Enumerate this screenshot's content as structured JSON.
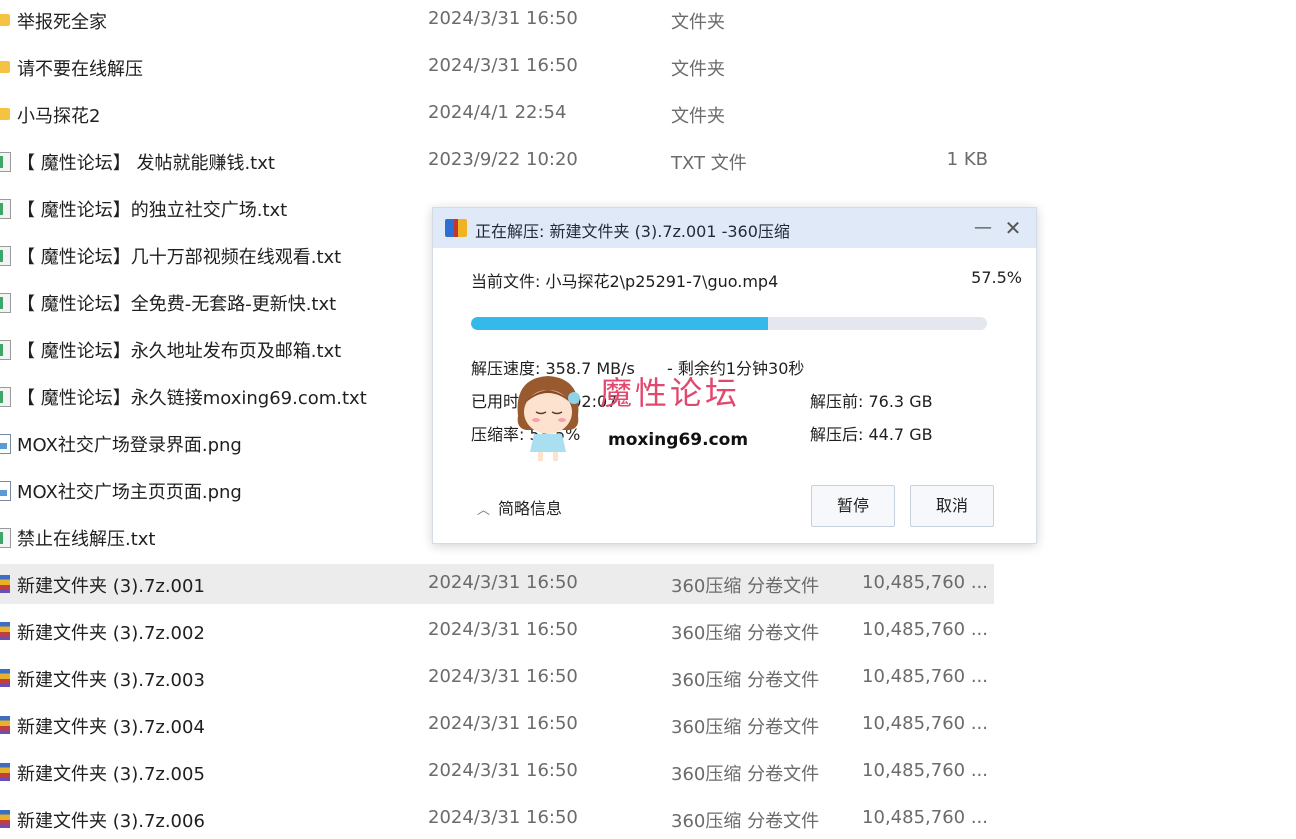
{
  "files": [
    {
      "icon": "folder-icon",
      "kind": "folder",
      "name": "举报死全家",
      "date": "2024/3/31 16:50",
      "type": "文件夹",
      "size": ""
    },
    {
      "icon": "folder-icon",
      "kind": "folder",
      "name": "请不要在线解压",
      "date": "2024/3/31 16:50",
      "type": "文件夹",
      "size": ""
    },
    {
      "icon": "folder-icon",
      "kind": "folder",
      "name": "小马探花2",
      "date": "2024/4/1 22:54",
      "type": "文件夹",
      "size": ""
    },
    {
      "icon": "txt-file-icon",
      "kind": "txt",
      "name": "【 魔性论坛】 发帖就能赚钱.txt",
      "date": "2023/9/22 10:20",
      "type": "TXT 文件",
      "size": "1 KB"
    },
    {
      "icon": "txt-file-icon",
      "kind": "txt",
      "name": "【 魔性论坛】的独立社交广场.txt",
      "date": "",
      "type": "",
      "size": ""
    },
    {
      "icon": "txt-file-icon",
      "kind": "txt",
      "name": "【 魔性论坛】几十万部视频在线观看.txt",
      "date": "",
      "type": "",
      "size": ""
    },
    {
      "icon": "txt-file-icon",
      "kind": "txt",
      "name": "【 魔性论坛】全免费-无套路-更新快.txt",
      "date": "",
      "type": "",
      "size": ""
    },
    {
      "icon": "txt-file-icon",
      "kind": "txt",
      "name": "【 魔性论坛】永久地址发布页及邮箱.txt",
      "date": "",
      "type": "",
      "size": ""
    },
    {
      "icon": "txt-file-icon",
      "kind": "txt",
      "name": "【 魔性论坛】永久链接moxing69.com.txt",
      "date": "",
      "type": "",
      "size": ""
    },
    {
      "icon": "png-file-icon",
      "kind": "png",
      "name": "MOX社交广场登录界面.png",
      "date": "",
      "type": "",
      "size": ""
    },
    {
      "icon": "png-file-icon",
      "kind": "png",
      "name": "MOX社交广场主页页面.png",
      "date": "",
      "type": "",
      "size": ""
    },
    {
      "icon": "txt-file-icon",
      "kind": "txt",
      "name": "禁止在线解压.txt",
      "date": "",
      "type": "",
      "size": ""
    },
    {
      "icon": "archive-icon",
      "kind": "zip",
      "name": "新建文件夹 (3).7z.001",
      "date": "2024/3/31 16:50",
      "type": "360压缩 分卷文件",
      "size": "10,485,760 ...",
      "selected": true
    },
    {
      "icon": "archive-icon",
      "kind": "zip",
      "name": "新建文件夹 (3).7z.002",
      "date": "2024/3/31 16:50",
      "type": "360压缩 分卷文件",
      "size": "10,485,760 ..."
    },
    {
      "icon": "archive-icon",
      "kind": "zip",
      "name": "新建文件夹 (3).7z.003",
      "date": "2024/3/31 16:50",
      "type": "360压缩 分卷文件",
      "size": "10,485,760 ..."
    },
    {
      "icon": "archive-icon",
      "kind": "zip",
      "name": "新建文件夹 (3).7z.004",
      "date": "2024/3/31 16:50",
      "type": "360压缩 分卷文件",
      "size": "10,485,760 ..."
    },
    {
      "icon": "archive-icon",
      "kind": "zip",
      "name": "新建文件夹 (3).7z.005",
      "date": "2024/3/31 16:50",
      "type": "360压缩 分卷文件",
      "size": "10,485,760 ..."
    },
    {
      "icon": "archive-icon",
      "kind": "zip",
      "name": "新建文件夹 (3).7z.006",
      "date": "2024/3/31 16:50",
      "type": "360压缩 分卷文件",
      "size": "10,485,760 ..."
    }
  ],
  "dialog": {
    "title": "正在解压: 新建文件夹 (3).7z.001 -360压缩",
    "current_file": "当前文件: 小马探花2\\p25291-7\\guo.mp4",
    "percent_text": "57.5%",
    "progress_fraction": 0.575,
    "speed": "解压速度: 358.7 MB/s",
    "remaining": "- 剩余约1分钟30秒",
    "used": "已用时间: 00:02:07",
    "ratio": "压缩率: 58.5%",
    "before": "解压前: 76.3 GB",
    "after": "解压后: 44.7 GB",
    "details_label": "简略信息",
    "pause_label": "暂停",
    "cancel_label": "取消",
    "minimize_glyph": "—",
    "close_glyph": "✕",
    "chevron_glyph": "︿"
  },
  "watermark": {
    "text": "魔性论坛",
    "url": "moxing69.com"
  },
  "colors": {
    "accent": "#35b8ea",
    "titlebar": "#dfe9f7",
    "selected_row": "#ececec",
    "watermark": "#e2486e"
  }
}
